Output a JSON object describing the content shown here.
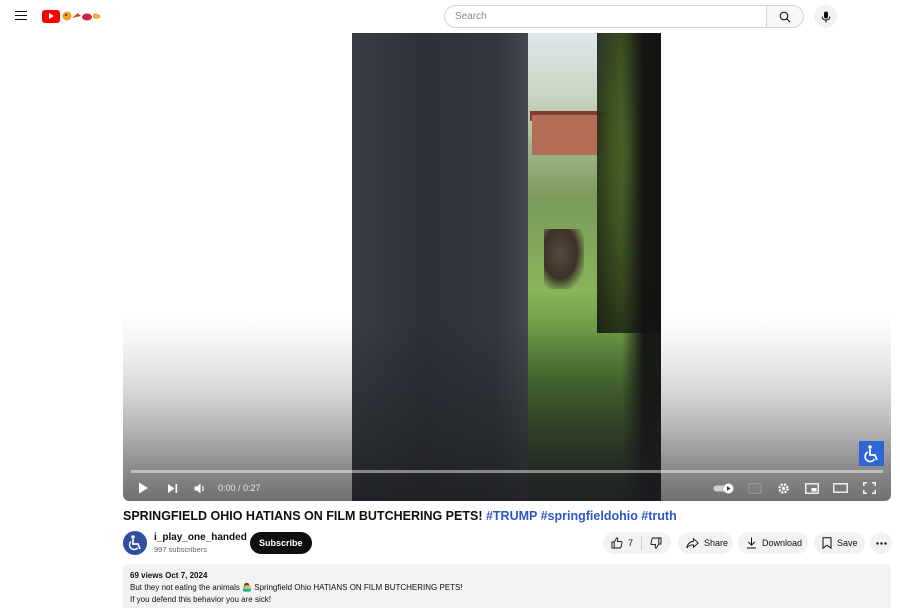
{
  "masthead": {
    "search_placeholder": "Search",
    "icons": [
      "menu-icon",
      "youtube-logo",
      "search-icon",
      "mic-icon"
    ]
  },
  "player": {
    "current_time": "0:00",
    "duration": "0:27",
    "time_display": "0:00 / 0:27",
    "progress_fraction": 0.0,
    "autoplay": "on",
    "icons": [
      "play-icon",
      "next-icon",
      "volume-icon",
      "autoplay-toggle",
      "captions-icon",
      "settings-icon",
      "miniplayer-icon",
      "theater-icon",
      "fullscreen-icon",
      "accessibility-icon"
    ],
    "accent_color": "#ffffff"
  },
  "video": {
    "title_main": "SPRINGFIELD OHIO HATIANS ON FILM BUTCHERING PETS! ",
    "title_tags": "#TRUMP #springfieldohio #truth",
    "tag_color": "#2f56c9"
  },
  "owner": {
    "channel_name": "i_play_one_handed",
    "subscribers": "997 subscribers",
    "subscribe_label": "Subscribe"
  },
  "actions": {
    "like_count": "7",
    "share_label": "Share",
    "download_label": "Download",
    "save_label": "Save"
  },
  "description": {
    "meta": "69 views  Oct 7, 2024",
    "line1": "But they not eating the animals 🤷‍♂️ Springfield Ohio HATIANS ON FILM BUTCHERING PETS!",
    "line2": "If you defend this behavior you are sick!"
  }
}
